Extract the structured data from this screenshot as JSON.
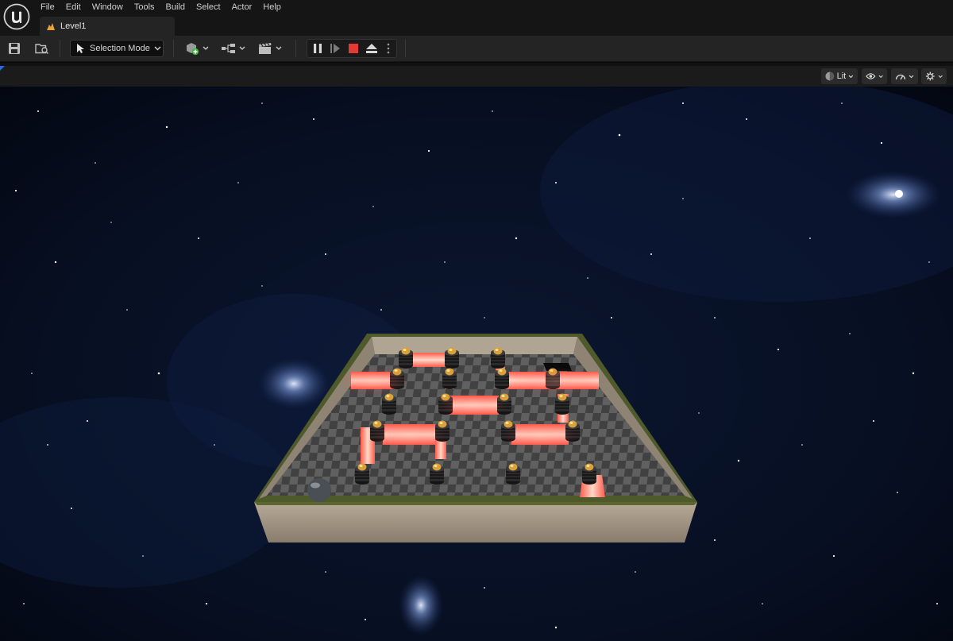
{
  "menu": [
    "File",
    "Edit",
    "Window",
    "Tools",
    "Build",
    "Select",
    "Actor",
    "Help"
  ],
  "tab": {
    "label": "Level1"
  },
  "toolbar": {
    "selection_mode": "Selection Mode"
  },
  "viewport": {
    "view_mode": "Lit"
  },
  "colors": {
    "accent": "#2a6ad8",
    "stop": "#e53935",
    "laser": "#ff4040"
  }
}
